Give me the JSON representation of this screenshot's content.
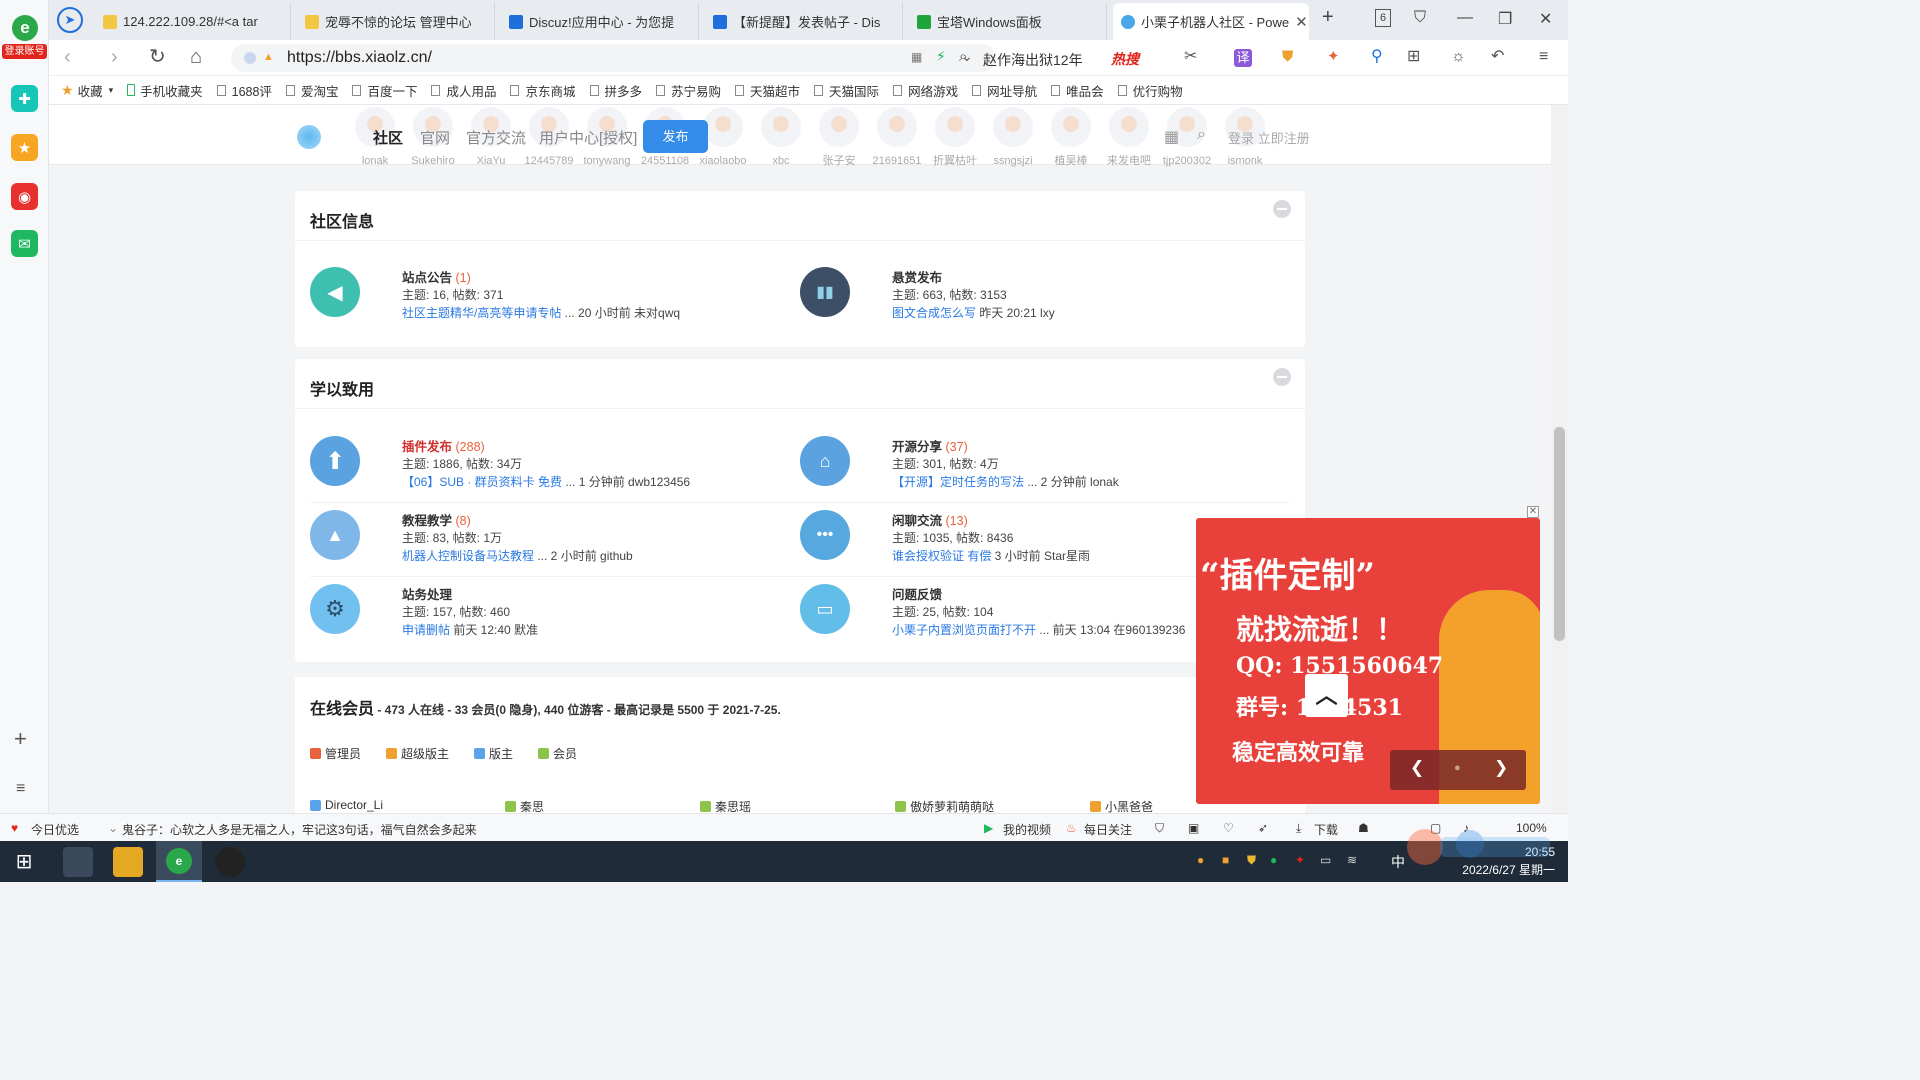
{
  "browser": {
    "login_badge": "登录账号",
    "tabs": [
      {
        "title": "124.222.109.28/#<a tar",
        "color": "#f2c744"
      },
      {
        "title": "宠辱不惊的论坛 管理中心",
        "color": "#f2c744"
      },
      {
        "title": "Discuz!应用中心 - 为您提",
        "color": "#1e6fd9"
      },
      {
        "title": "【新提醒】发表帖子 - Dis",
        "color": "#1e6fd9"
      },
      {
        "title": "宝塔Windows面板",
        "color": "#20a53a"
      },
      {
        "title": "小栗子机器人社区 - Powe",
        "color": "#4aa8e8",
        "active": true
      }
    ],
    "tab_count": "6",
    "url": "https://bbs.xiaolz.cn/",
    "search_query": "赵作海出狱12年",
    "search_hot": "热搜",
    "bookmarks": [
      "收藏",
      "手机收藏夹",
      "1688评",
      "爱淘宝",
      "百度一下",
      "成人用品",
      "京东商城",
      "拼多多",
      "苏宁易购",
      "天猫超市",
      "天猫国际",
      "网络游戏",
      "网址导航",
      "唯品会",
      "优行购物"
    ]
  },
  "site": {
    "members_strip": [
      "lonak",
      "Sukehiro",
      "XiaYu",
      "12445789",
      "tonywang",
      "24551108",
      "xiaolaobo",
      "xbc",
      "张子安",
      "21691651",
      "折翼枯叶",
      "ssngsjzi",
      "植吴棒",
      "来发电吧",
      "tjp200302",
      "ismonk"
    ],
    "nav": {
      "community": "社区",
      "official": "官网",
      "exchange": "官方交流",
      "user_center": "用户中心[授权]",
      "post": "发布",
      "login": "登录 立即注册"
    }
  },
  "sections": [
    {
      "title": "社区信息",
      "forums": [
        {
          "name": "站点公告",
          "count": "(1)",
          "stats": "主题: 16, 帖数: 371",
          "last_link": "社区主题精华/高亮等申请专帖",
          "last_meta": " ... 20 小时前 未对qwq",
          "icon_color": "#3fbfb0",
          "icon": "📣"
        },
        {
          "name": "悬赏发布",
          "count": "",
          "stats": "主题: 663, 帖数: 3153",
          "last_link": "图文合成怎么写",
          "last_meta": " 昨天 20:21 lxy",
          "icon_color": "#3d4f66",
          "icon": "▮▮"
        }
      ]
    },
    {
      "title": "学以致用",
      "forums": [
        {
          "name": "插件发布",
          "count": "(288)",
          "stats": "主题: 1886, 帖数: 34万",
          "last_link": "【06】SUB · 群员资料卡 免费",
          "last_meta": " ... 1 分钟前 dwb123456",
          "icon_color": "#5aa3e0",
          "icon": "⬆",
          "name_color": "#d0312d"
        },
        {
          "name": "开源分享",
          "count": "(37)",
          "stats": "主题: 301, 帖数: 4万",
          "last_link": "【开源】定时任务的写法",
          "last_meta": " ... 2 分钟前 lonak",
          "icon_color": "#5aa3e0",
          "icon": "🏪"
        },
        {
          "name": "教程教学",
          "count": "(8)",
          "stats": "主题: 83, 帖数: 1万",
          "last_link": "机器人控制设备马达教程",
          "last_meta": " ... 2 小时前 github",
          "icon_color": "#7fb8e8",
          "icon": "🚀"
        },
        {
          "name": "闲聊交流",
          "count": "(13)",
          "stats": "主题: 1035, 帖数: 8436",
          "last_link": "谁会授权验证 有偿",
          "last_meta": " 3 小时前 Star星雨",
          "icon_color": "#58a8e0",
          "icon": "💬"
        },
        {
          "name": "站务处理",
          "count": "",
          "stats": "主题: 157, 帖数: 460",
          "last_link": "申请删帖",
          "last_meta": " 前天 12:40 默准",
          "icon_color": "#72c0ef",
          "icon": "⚙"
        },
        {
          "name": "问题反馈",
          "count": "",
          "stats": "主题: 25, 帖数: 104",
          "last_link": "小栗子内置浏览页面打不开",
          "last_meta": " ... 前天 13:04 在960139236",
          "icon_color": "#62bde8",
          "icon": "🖥"
        }
      ]
    }
  ],
  "online": {
    "title": "在线会员",
    "summary": " - 473 人在线 - 33 会员(0 隐身), 440 位游客 - 最高记录是 5500 于 2021-7-25.",
    "legend": [
      {
        "label": "管理员",
        "color": "#e8613c"
      },
      {
        "label": "超级版主",
        "color": "#f0a030"
      },
      {
        "label": "版主",
        "color": "#5aa3e8"
      },
      {
        "label": "会员",
        "color": "#8cc34a"
      }
    ],
    "members": [
      "Director_Li",
      "秦思",
      "秦思瑶",
      "傲娇萝莉萌萌哒",
      "小黑爸爸"
    ]
  },
  "ad": {
    "line1": "“插件定制”",
    "line2": "就找流逝！！",
    "line3": "QQ: 1551560647",
    "line4": "群号: 1234531",
    "line5": "稳定高效可靠"
  },
  "statusbar": {
    "today": "今日优选",
    "news": "鬼谷子：心软之人多是无福之人，牢记这3句话，福气自然会多起来",
    "video": "我的视频",
    "follow": "每日关注",
    "download": "下载",
    "zoom": "100%"
  },
  "taskbar": {
    "time": "20:55",
    "date": "2022/6/27 星期一",
    "ime": "中"
  }
}
